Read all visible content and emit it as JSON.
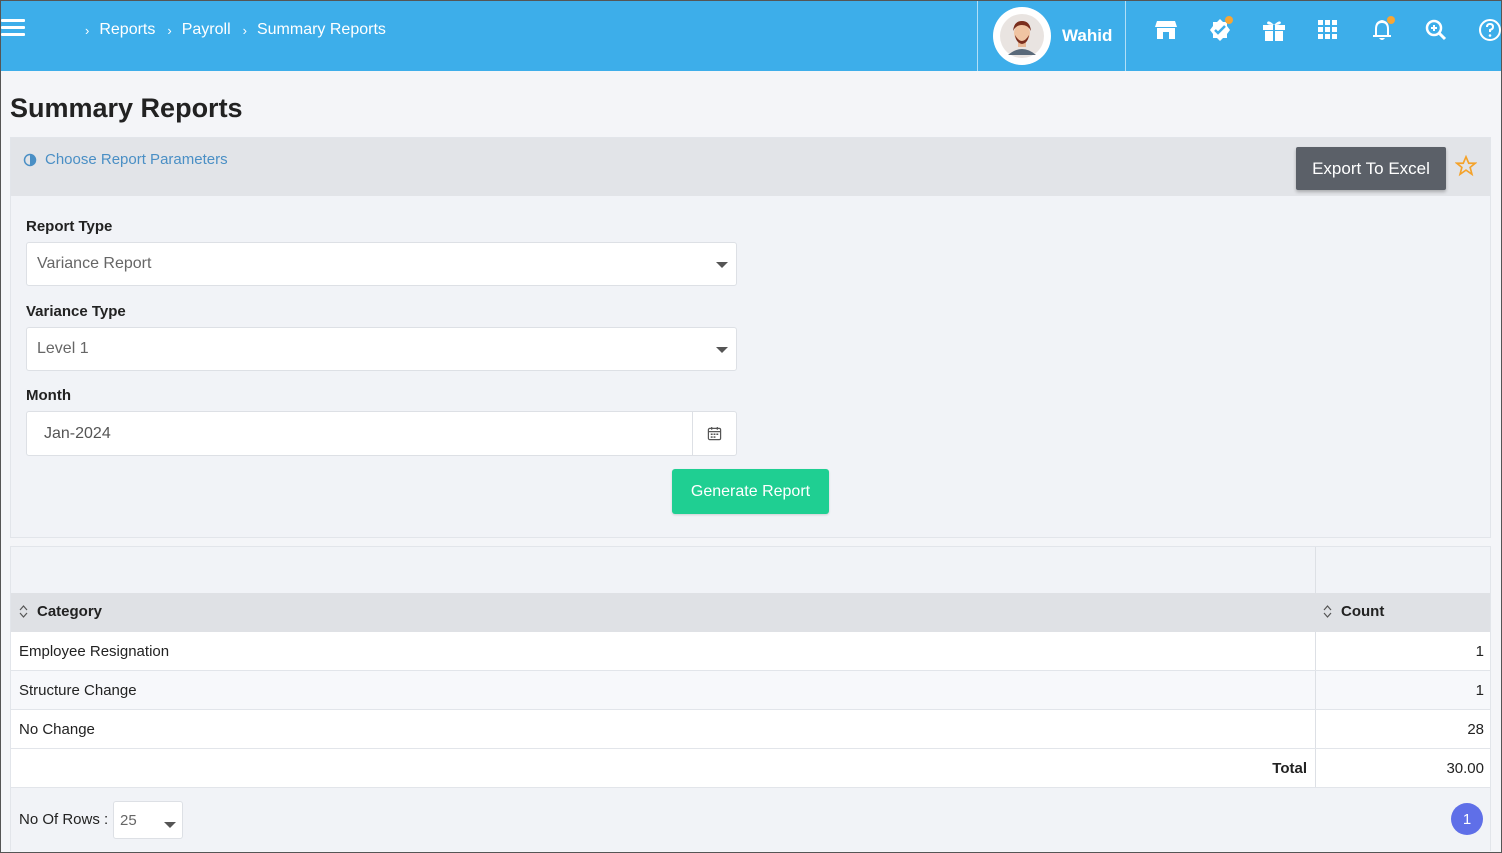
{
  "header": {
    "breadcrumbs": [
      "Reports",
      "Payroll",
      "Summary Reports"
    ],
    "user_name": "Wahid",
    "icons": [
      "store-icon",
      "verified-icon",
      "gift-icon",
      "apps-grid-icon",
      "bell-icon",
      "search-zoom-icon",
      "help-icon"
    ],
    "accent": "#3daeea"
  },
  "page": {
    "title": "Summary Reports"
  },
  "params": {
    "choose_label": "Choose Report Parameters",
    "export_label": "Export To Excel",
    "report_type_label": "Report Type",
    "report_type_value": "Variance Report",
    "variance_type_label": "Variance Type",
    "variance_type_value": "Level 1",
    "month_label": "Month",
    "month_value": "Jan-2024",
    "generate_label": "Generate Report"
  },
  "table": {
    "col_category": "Category",
    "col_count": "Count",
    "rows": [
      {
        "category": "Employee Resignation",
        "count": "1"
      },
      {
        "category": "Structure Change",
        "count": "1"
      },
      {
        "category": "No Change",
        "count": "28"
      }
    ],
    "total_label": "Total",
    "total_value": "30.00",
    "rows_label": "No Of Rows :",
    "rows_value": "25",
    "page": "1"
  }
}
